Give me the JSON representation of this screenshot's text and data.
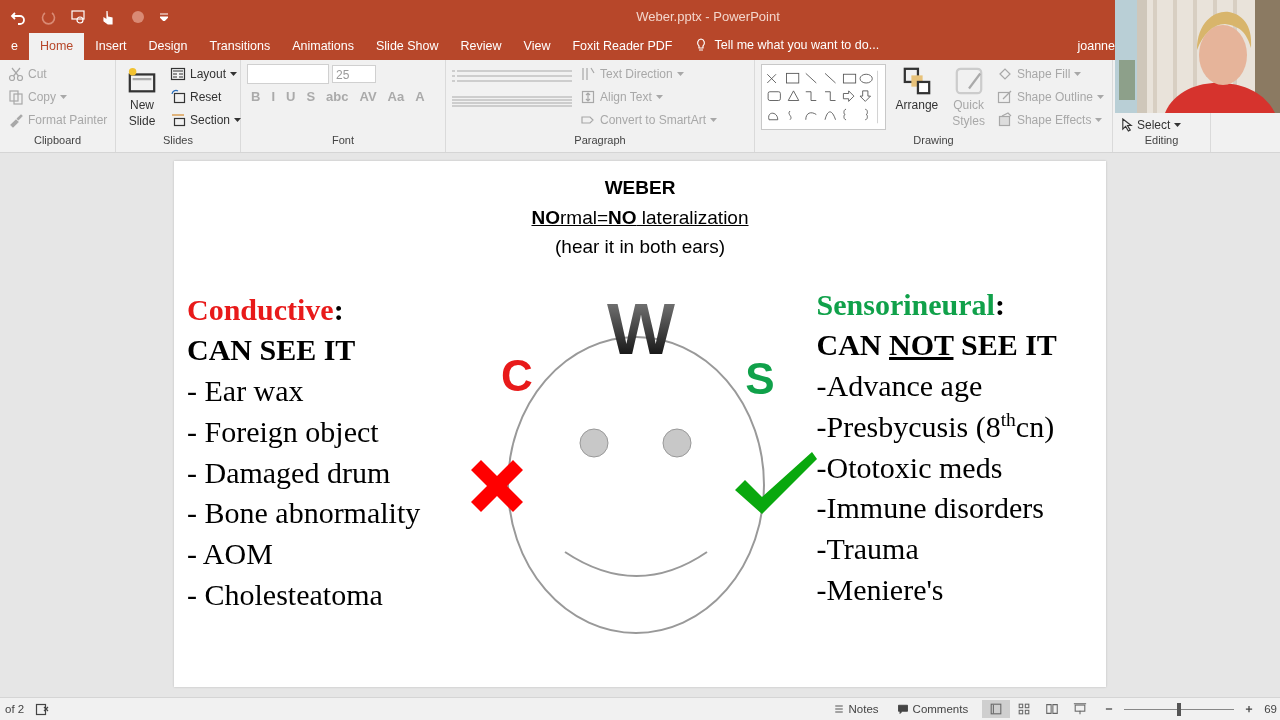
{
  "title_bar": {
    "title": "Weber.pptx - PowerPoint"
  },
  "tabs": [
    {
      "label": "e",
      "selected": false
    },
    {
      "label": "Home",
      "selected": true
    },
    {
      "label": "Insert",
      "selected": false
    },
    {
      "label": "Design",
      "selected": false
    },
    {
      "label": "Transitions",
      "selected": false
    },
    {
      "label": "Animations",
      "selected": false
    },
    {
      "label": "Slide Show",
      "selected": false
    },
    {
      "label": "Review",
      "selected": false
    },
    {
      "label": "View",
      "selected": false
    },
    {
      "label": "Foxit Reader PDF",
      "selected": false
    }
  ],
  "tell_me": "Tell me what you want to do...",
  "user": "joanne",
  "ribbon": {
    "clipboard": {
      "label": "Clipboard",
      "items": [
        {
          "label": "Cut",
          "disabled": true
        },
        {
          "label": "Copy",
          "disabled": true
        },
        {
          "label": "Format Painter",
          "disabled": true
        }
      ]
    },
    "slides": {
      "label": "Slides",
      "new_slide": [
        "New",
        "Slide"
      ],
      "items": [
        {
          "label": "Layout",
          "disabled": false
        },
        {
          "label": "Reset",
          "disabled": false
        },
        {
          "label": "Section",
          "disabled": false
        }
      ]
    },
    "font": {
      "label": "Font",
      "size": "25",
      "buttons": [
        "B",
        "I",
        "U",
        "S",
        "abc",
        "AV",
        "Aa",
        "A"
      ]
    },
    "paragraph": {
      "label": "Paragraph",
      "items": [
        {
          "label": "Text Direction",
          "disabled": true
        },
        {
          "label": "Align Text",
          "disabled": true
        },
        {
          "label": "Convert to SmartArt",
          "disabled": true
        }
      ]
    },
    "drawing": {
      "label": "Drawing",
      "arrange": "Arrange",
      "quick_styles": [
        "Quick",
        "Styles"
      ],
      "items": [
        {
          "label": "Shape Fill",
          "disabled": true
        },
        {
          "label": "Shape Outline",
          "disabled": true
        },
        {
          "label": "Shape Effects",
          "disabled": true
        }
      ]
    },
    "editing": {
      "label": "Editing",
      "select": "Select"
    }
  },
  "slide": {
    "title": [
      "WEBER",
      "**NO**rmal=**NO** lateralization",
      "(hear it in both ears)"
    ],
    "left": {
      "heading": "Conductive",
      "colon": ":",
      "subheading": "CAN SEE IT",
      "items": [
        "- Ear wax",
        "- Foreign object",
        "- Damaged drum",
        "- Bone abnormality",
        "- AOM",
        "- Cholesteatoma"
      ]
    },
    "diagram": {
      "top": "W",
      "left_letter": "C",
      "right_letter": "S"
    },
    "right": {
      "heading": "Sensorineural",
      "colon": ":",
      "subheading": {
        "before": "CAN ",
        "emphasis": "NOT",
        "after": " SEE IT"
      },
      "items": [
        "-Advance age",
        "-Presbycusis (8$^{th}$cn)",
        "-Ototoxic meds",
        "-Immune disorders",
        "-Trauma",
        "-Meniere's"
      ]
    }
  },
  "status_bar": {
    "slide": "of 2",
    "notes": "Notes",
    "comments": "Comments",
    "views": [
      {
        "kind": "normal",
        "selected": true
      },
      {
        "kind": "sorter",
        "selected": false
      },
      {
        "kind": "reading",
        "selected": false
      },
      {
        "kind": "show",
        "selected": false
      }
    ],
    "level": 0.5,
    "zoom": "69"
  }
}
